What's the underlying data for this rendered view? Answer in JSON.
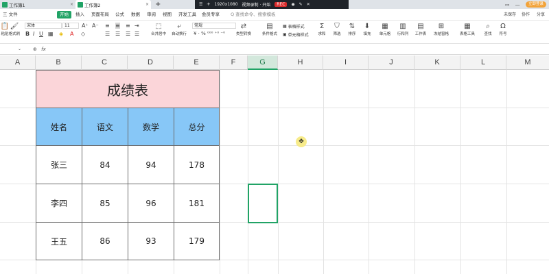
{
  "titlebar": {
    "tabs": [
      {
        "label": "工作簿1",
        "active": false
      },
      {
        "label": "工作簿2",
        "active": true
      }
    ],
    "new_tab": "+",
    "recorder": {
      "resolution": "1920x1080",
      "status": "视频录制 · 开始",
      "rec": "REC"
    },
    "login": "立即登录"
  },
  "menu": {
    "items": [
      "三 文件",
      "开始",
      "插入",
      "页面布局",
      "公式",
      "数据",
      "审阅",
      "视图",
      "开发工具",
      "会员专享"
    ],
    "active": "开始",
    "search": "Q 查找命令、搜索模板",
    "right": [
      "未保存",
      "协作",
      "分享"
    ]
  },
  "ribbon": {
    "paste": "粘贴",
    "format_painter": "格式刷",
    "font": "宋体",
    "font_size": "11",
    "merge": "合并居中",
    "wrap": "自动换行",
    "number_format": "常规",
    "type_convert": "类型转换",
    "conditional": "条件格式",
    "table_style": "表格样式",
    "cell_style": "单元格样式",
    "sum": "求和",
    "filter": "筛选",
    "sort": "排序",
    "fill": "填充",
    "cell": "单元格",
    "row_col": "行和列",
    "worksheet": "工作表",
    "freeze": "冻结窗格",
    "table_tools": "表格工具",
    "find": "查找",
    "symbol": "符号"
  },
  "formula_bar": {
    "fx": "fx",
    "value": ""
  },
  "columns": [
    "A",
    "B",
    "C",
    "D",
    "E",
    "F",
    "G",
    "H",
    "I",
    "J",
    "K",
    "L",
    "M"
  ],
  "selected_column": "G",
  "table": {
    "title": "成绩表",
    "headers": [
      "姓名",
      "语文",
      "数学",
      "总分"
    ],
    "rows": [
      [
        "张三",
        "84",
        "94",
        "178"
      ],
      [
        "李四",
        "85",
        "96",
        "181"
      ],
      [
        "王五",
        "86",
        "93",
        "179"
      ]
    ]
  },
  "colors": {
    "accent": "#21a366",
    "title_fill": "#fbd5d9",
    "header_fill": "#87c7f7"
  }
}
